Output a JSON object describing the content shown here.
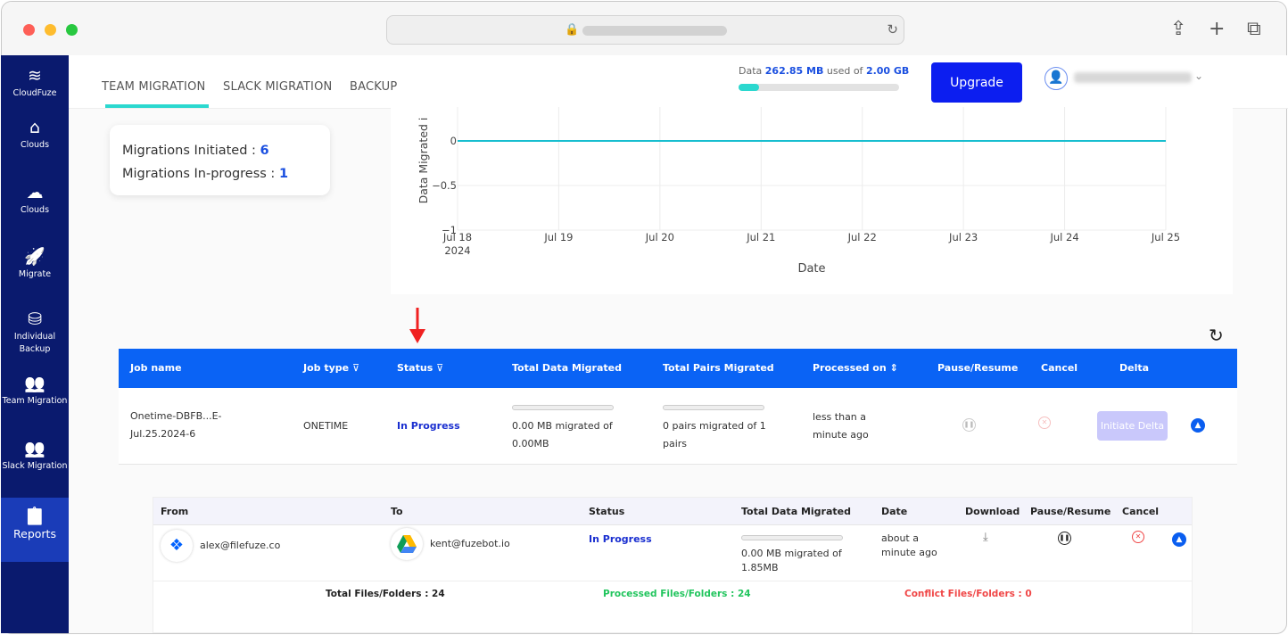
{
  "browser": {
    "lock_icon": "lock-icon",
    "reload_icon": "reload-icon"
  },
  "sidebar": {
    "brand": "CloudFuze",
    "items": [
      {
        "label": "Clouds",
        "icon": "home-icon",
        "glyph": "⌂"
      },
      {
        "label": "Clouds",
        "icon": "cloud-icon",
        "glyph": "☁"
      },
      {
        "label": "Migrate",
        "icon": "rocket-icon",
        "glyph": "🚀"
      },
      {
        "label": "Individual Backup",
        "icon": "database-icon",
        "glyph": "⛁"
      },
      {
        "label": "Team Migration",
        "icon": "users-icon",
        "glyph": "👥"
      },
      {
        "label": "Slack Migration",
        "icon": "users-icon",
        "glyph": "👥"
      },
      {
        "label": "Reports",
        "icon": "clipboard-icon",
        "glyph": "📋",
        "active": true
      }
    ]
  },
  "topnav": {
    "tabs": [
      "TEAM MIGRATION",
      "SLACK MIGRATION",
      "BACKUP"
    ],
    "active_tab": 0,
    "usage": {
      "prefix": "Data",
      "used": "262.85 MB",
      "mid": "used of",
      "total": "2.00 GB",
      "fraction": 0.128
    },
    "upgrade_label": "Upgrade"
  },
  "stats": {
    "initiated_label": "Migrations Initiated :",
    "initiated": "6",
    "inprogress_label": "Migrations In-progress :",
    "inprogress": "1"
  },
  "chart_data": {
    "type": "line",
    "xlabel": "Date",
    "ylabel": "Data Migrated i",
    "x_ticks": [
      "Jul 18",
      "Jul 19",
      "Jul 20",
      "Jul 21",
      "Jul 22",
      "Jul 23",
      "Jul 24",
      "Jul 25"
    ],
    "x_year": "2024",
    "y_ticks": [
      "0",
      "−0.5",
      "−1"
    ],
    "y_tick_values": [
      0,
      -0.5,
      -1
    ],
    "x": [
      "2024-07-18",
      "2024-07-25"
    ],
    "values": [
      0,
      0
    ],
    "grid": true,
    "line_color": "#17becf"
  },
  "jobs": {
    "headers": [
      "Job name",
      "Job type",
      "Status",
      "Total Data Migrated",
      "Total Pairs Migrated",
      "Processed on",
      "Pause/Resume",
      "Cancel",
      "Delta"
    ],
    "row": {
      "name_line1": "Onetime-DBFB...E-",
      "name_line2": "Jul.25.2024-6",
      "type": "ONETIME",
      "status": "In Progress",
      "data_line1": "0.00 MB migrated of",
      "data_line2": "0.00MB",
      "pairs_line1": "0 pairs migrated of 1",
      "pairs_line2": "pairs",
      "processed_line1": "less than a",
      "processed_line2": "minute ago",
      "delta_label": "Initiate Delta"
    }
  },
  "pairs": {
    "headers": [
      "From",
      "To",
      "Status",
      "Total Data Migrated",
      "Date",
      "Download",
      "Pause/Resume",
      "Cancel"
    ],
    "row": {
      "from": "alex@filefuze.co",
      "to": "kent@fuzebot.io",
      "status": "In Progress",
      "data_line1": "0.00 MB migrated of",
      "data_line2": "1.85MB",
      "date_line1": "about a",
      "date_line2": "minute ago"
    },
    "totals": {
      "total": "Total Files/Folders : 24",
      "processed": "Processed Files/Folders : 24",
      "conflict": "Conflict Files/Folders : 0"
    }
  },
  "colors": {
    "sidebar": "#0a1a6e",
    "accent": "#0a63f5",
    "upgrade": "#0c1ef0",
    "teal": "#2bd8cf",
    "success": "#22c55e",
    "danger": "#f04747"
  }
}
